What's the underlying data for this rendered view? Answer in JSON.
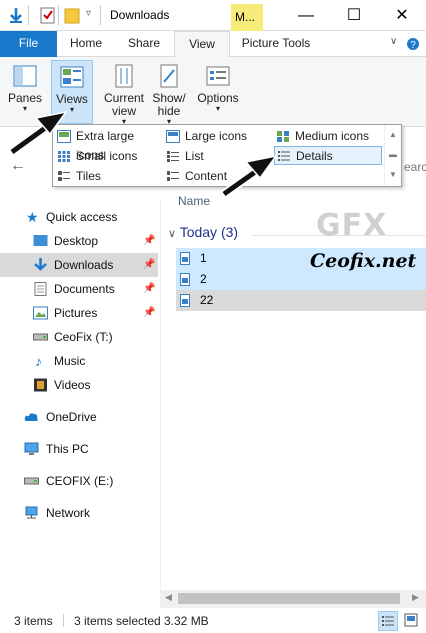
{
  "window": {
    "title": "Downloads",
    "contextual_tab_short": "M...",
    "minimize": "—",
    "maximize": "☐",
    "close": "✕"
  },
  "ribbon_tabs": {
    "file": "File",
    "home": "Home",
    "share": "Share",
    "view": "View",
    "picture_tools": "Picture Tools"
  },
  "ribbon": {
    "panes": "Panes",
    "views": "Views",
    "current_view_1": "Current",
    "current_view_2": "view",
    "show_hide_1": "Show/",
    "show_hide_2": "hide",
    "options": "Options"
  },
  "views_menu": {
    "extra_large_icons": "Extra large icons",
    "large_icons": "Large icons",
    "medium_icons": "Medium icons",
    "small_icons": "Small icons",
    "list": "List",
    "details": "Details",
    "tiles": "Tiles",
    "content": "Content"
  },
  "search_hint": "earch",
  "nav": {
    "quick_access": "Quick access",
    "desktop": "Desktop",
    "downloads": "Downloads",
    "documents": "Documents",
    "pictures": "Pictures",
    "ceofix_t": "CeoFix (T:)",
    "music": "Music",
    "videos": "Videos",
    "onedrive": "OneDrive",
    "this_pc": "This PC",
    "ceofix_e": "CEOFIX (E:)",
    "network": "Network"
  },
  "content": {
    "column_name": "Name",
    "group": "Today (3)",
    "files": [
      "1",
      "2",
      "22"
    ]
  },
  "watermark": {
    "logo": "GFX",
    "text": "Ceofix.net"
  },
  "status": {
    "items": "3 items",
    "selected": "3 items selected",
    "size": "3.32 MB"
  },
  "colors": {
    "accent": "#1979ca",
    "selection": "#cde8ff",
    "manage_tab": "#f7ec7a"
  }
}
